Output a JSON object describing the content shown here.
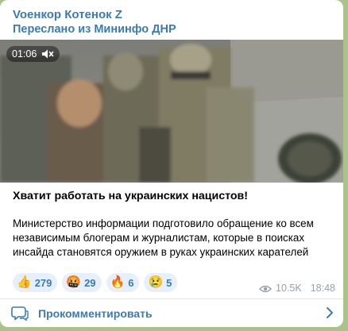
{
  "post": {
    "channel": "Voенкор Котенок Z",
    "forwarded_from": "Переслано из Мининфо ДНР",
    "video": {
      "duration": "01:06",
      "muted": true
    },
    "headline": "Хватит работать на украинских нацистов!",
    "body": "Министерство информации подготовило обращение ко всем независимым блогерам и журналистам, которые в поисках инсайда становятся оружием в руках украинских карателей",
    "reactions": [
      {
        "emoji": "👍",
        "count": "279"
      },
      {
        "emoji": "🤬",
        "count": "29"
      },
      {
        "emoji": "🔥",
        "count": "6"
      },
      {
        "emoji": "😢",
        "count": "5"
      }
    ],
    "views": "10.5K",
    "time": "18:48",
    "comment_label": "Прокомментировать"
  },
  "colors": {
    "background": "#a9c38a",
    "accent": "#3a7bb6",
    "reaction_bg": "#e6effa",
    "meta": "#98a0a8"
  }
}
